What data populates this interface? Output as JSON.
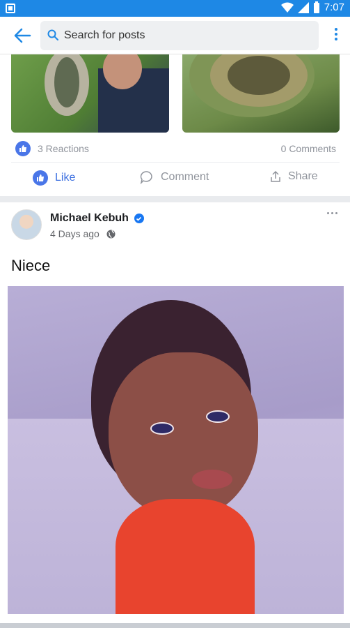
{
  "status_bar": {
    "time": "7:07"
  },
  "toolbar": {
    "search_placeholder": "Search for posts"
  },
  "top_post": {
    "reactions_label": "3 Reactions",
    "comments_label": "0 Comments",
    "actions": {
      "like": "Like",
      "comment": "Comment",
      "share": "Share"
    }
  },
  "main_post": {
    "author": "Michael Kebuh",
    "time": "4 Days ago",
    "text": "Niece"
  },
  "colors": {
    "accent": "#1e88e5",
    "like_blue": "#3b6fe0",
    "muted": "#90949c"
  },
  "icons": [
    "back-arrow-icon",
    "search-icon",
    "more-vert-icon",
    "like-icon",
    "comment-icon",
    "share-icon",
    "verified-icon",
    "globe-icon"
  ]
}
